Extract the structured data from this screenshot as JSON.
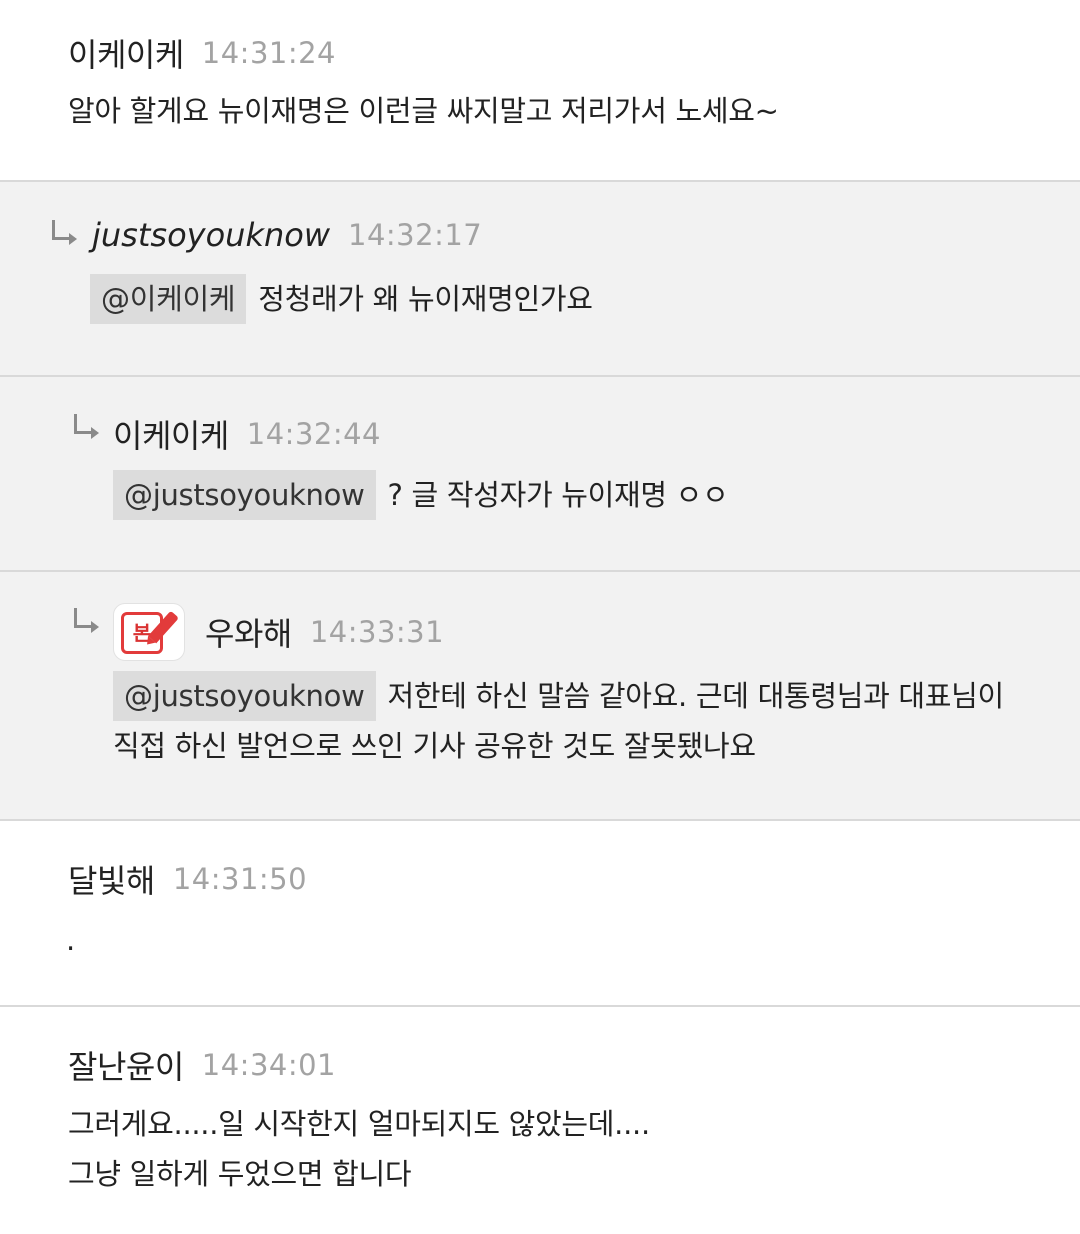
{
  "comments": [
    {
      "nickname": "이케이케",
      "time": "14:31:24",
      "lines": [
        "알아 할게요 뉴이재명은 이런글 싸지말고 저리가서 노세요~"
      ]
    },
    {
      "nickname": "justsoyouknow",
      "time": "14:32:17",
      "mention": "@이케이케",
      "text": "정청래가 왜 뉴이재명인가요"
    },
    {
      "nickname": "이케이케",
      "time": "14:32:44",
      "mention": "@justsoyouknow",
      "text": "? 글 작성자가 뉴이재명 ㅇㅇ"
    },
    {
      "nickname": "우와해",
      "time": "14:33:31",
      "badge_text": "본",
      "mention": "@justsoyouknow",
      "text": "저한테 하신 말씀 같아요. 근데 대통령님과 대표님이",
      "text2": "직접 하신 발언으로 쓰인 기사 공유한 것도 잘못됐나요"
    },
    {
      "nickname": "달빛해",
      "time": "14:31:50",
      "lines": [
        "."
      ]
    },
    {
      "nickname": "잘난윤이",
      "time": "14:34:01",
      "lines": [
        "그러게요.....일 시작한지 얼마되지도 않았는데....",
        "그냥 일하게 두었으면 합니다"
      ]
    }
  ],
  "icons": {
    "reply": "reply-arrow-icon",
    "badge": "author-pencil-badge-icon"
  },
  "colors": {
    "reply_background": "#f2f2f2",
    "mention_background": "#dcdcdc",
    "timestamp": "#a3a3a3",
    "badge_red": "#e23b3b"
  }
}
